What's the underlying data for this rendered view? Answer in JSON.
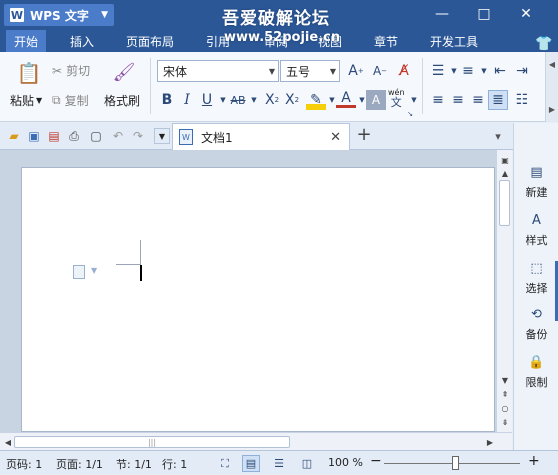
{
  "titlebar": {
    "app_name": "WPS 文字",
    "watermark": "吾爱破解论坛",
    "watermark_url": "www.52pojie.cn",
    "controls": {
      "skin": "👕",
      "minimize": "—",
      "maximize": "□",
      "close": "✕"
    }
  },
  "menu": {
    "tabs": [
      {
        "label": "开始",
        "active": true
      },
      {
        "label": "插入"
      },
      {
        "label": "页面布局"
      },
      {
        "label": "引用"
      },
      {
        "label": "审阅"
      },
      {
        "label": "视图"
      },
      {
        "label": "章节"
      },
      {
        "label": "开发工具"
      }
    ]
  },
  "ribbon": {
    "paste": "粘贴",
    "cut": "剪切",
    "copy": "复制",
    "format_painter": "格式刷",
    "font_name": "宋体",
    "font_size": "五号",
    "phonetic": "wén",
    "phonetic_char": "文"
  },
  "document": {
    "tab_title": "文档1"
  },
  "taskpane": {
    "items": [
      {
        "label": "新建",
        "icon": "new-doc-icon"
      },
      {
        "label": "样式",
        "icon": "style-icon"
      },
      {
        "label": "选择",
        "icon": "select-icon"
      },
      {
        "label": "备份",
        "icon": "backup-icon"
      },
      {
        "label": "限制",
        "icon": "restrict-icon"
      }
    ]
  },
  "status": {
    "page_num": "页码: 1",
    "pages": "页面: 1/1",
    "section": "节: 1/1",
    "row": "行: 1",
    "zoom": "100 %",
    "zoom_percent": 100
  },
  "colors": {
    "title_bg": "#2b5797",
    "tab_active": "#4a7cc9",
    "ribbon_bg": "#f5f8fc",
    "accent": "#3a6db3"
  }
}
